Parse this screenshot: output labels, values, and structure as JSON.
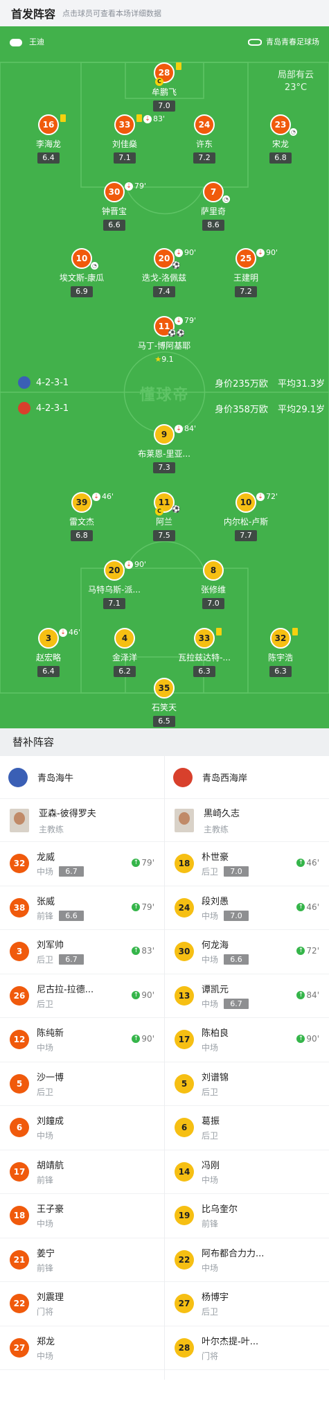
{
  "header": {
    "title": "首发阵容",
    "subtitle": "点击球员可查看本场详细数据"
  },
  "pitch_info": {
    "referee": "王迪",
    "stadium": "青岛青春足球场",
    "weather": "局部有云",
    "temperature": "23°C",
    "watermark": "懂球帝"
  },
  "colors": {
    "pitch": "#42b14b",
    "home": "#f05a0c",
    "away": "#f6bf13"
  },
  "home_team": {
    "name": "青岛海牛",
    "formation": "4-2-3-1",
    "value": "身价235万欧",
    "avg_age": "平均31.3岁",
    "players": [
      {
        "num": "28",
        "name": "牟鹏飞",
        "rating": "7.0"
      },
      {
        "num": "16",
        "name": "李海龙",
        "rating": "6.4"
      },
      {
        "num": "33",
        "name": "刘佳燊",
        "rating": "7.1",
        "sub_min": "83'"
      },
      {
        "num": "24",
        "name": "许东",
        "rating": "7.2"
      },
      {
        "num": "23",
        "name": "宋龙",
        "rating": "6.8"
      },
      {
        "num": "30",
        "name": "钟晋宝",
        "rating": "6.6",
        "sub_min": "79'"
      },
      {
        "num": "7",
        "name": "萨里奇",
        "rating": "8.6"
      },
      {
        "num": "10",
        "name": "埃文斯-康瓜",
        "rating": "6.9"
      },
      {
        "num": "20",
        "name": "迭戈-洛佩兹",
        "rating": "7.4",
        "sub_min": "90'"
      },
      {
        "num": "25",
        "name": "王建明",
        "rating": "7.2",
        "sub_min": "90'"
      },
      {
        "num": "11",
        "name": "马丁-博阿基耶",
        "rating": "9.1",
        "sub_min": "79'"
      }
    ]
  },
  "away_team": {
    "name": "青岛西海岸",
    "formation": "4-2-3-1",
    "value": "身价358万欧",
    "avg_age": "平均29.1岁",
    "players": [
      {
        "num": "9",
        "name": "布莱恩-里亚...",
        "rating": "7.3",
        "sub_min": "84'"
      },
      {
        "num": "39",
        "name": "雷文杰",
        "rating": "6.8",
        "sub_min": "46'"
      },
      {
        "num": "11",
        "name": "阿兰",
        "rating": "7.5"
      },
      {
        "num": "10",
        "name": "内尔松-卢斯",
        "rating": "7.7",
        "sub_min": "72'"
      },
      {
        "num": "20",
        "name": "马特乌斯-派...",
        "rating": "7.1",
        "sub_min": "90'"
      },
      {
        "num": "8",
        "name": "张修维",
        "rating": "7.0"
      },
      {
        "num": "3",
        "name": "赵宏略",
        "rating": "6.4",
        "sub_min": "46'"
      },
      {
        "num": "4",
        "name": "金泽洋",
        "rating": "6.2"
      },
      {
        "num": "33",
        "name": "瓦拉兹达特-...",
        "rating": "6.3"
      },
      {
        "num": "32",
        "name": "陈宇浩",
        "rating": "6.3"
      },
      {
        "num": "35",
        "name": "石笑天",
        "rating": "6.5"
      }
    ]
  },
  "subs": {
    "title": "替补阵容",
    "home": {
      "team": "青岛海牛",
      "coach": {
        "name": "亚森-彼得罗夫",
        "role": "主教练"
      },
      "players": [
        {
          "num": "32",
          "name": "龙威",
          "pos": "中场",
          "rating": "6.7",
          "on": "79'"
        },
        {
          "num": "38",
          "name": "张威",
          "pos": "前锋",
          "rating": "6.6",
          "on": "79'"
        },
        {
          "num": "3",
          "name": "刘军帅",
          "pos": "后卫",
          "rating": "6.7",
          "on": "83'"
        },
        {
          "num": "26",
          "name": "尼古拉-拉德...",
          "pos": "后卫",
          "rating": "",
          "on": "90'"
        },
        {
          "num": "12",
          "name": "陈纯新",
          "pos": "中场",
          "rating": "",
          "on": "90'"
        },
        {
          "num": "5",
          "name": "沙一博",
          "pos": "后卫",
          "rating": "",
          "on": ""
        },
        {
          "num": "6",
          "name": "刘鐘成",
          "pos": "中场",
          "rating": "",
          "on": ""
        },
        {
          "num": "17",
          "name": "胡靖航",
          "pos": "前锋",
          "rating": "",
          "on": ""
        },
        {
          "num": "18",
          "name": "王子豪",
          "pos": "中场",
          "rating": "",
          "on": ""
        },
        {
          "num": "21",
          "name": "姜宁",
          "pos": "前锋",
          "rating": "",
          "on": ""
        },
        {
          "num": "22",
          "name": "刘震理",
          "pos": "门将",
          "rating": "",
          "on": ""
        },
        {
          "num": "27",
          "name": "郑龙",
          "pos": "中场",
          "rating": "",
          "on": ""
        }
      ]
    },
    "away": {
      "team": "青岛西海岸",
      "coach": {
        "name": "黒崎久志",
        "role": "主教练"
      },
      "players": [
        {
          "num": "18",
          "name": "朴世豪",
          "pos": "后卫",
          "rating": "7.0",
          "on": "46'"
        },
        {
          "num": "24",
          "name": "段刘愚",
          "pos": "中场",
          "rating": "7.0",
          "on": "46'"
        },
        {
          "num": "30",
          "name": "何龙海",
          "pos": "中场",
          "rating": "6.6",
          "on": "72'"
        },
        {
          "num": "13",
          "name": "谭凯元",
          "pos": "中场",
          "rating": "6.7",
          "on": "84'"
        },
        {
          "num": "17",
          "name": "陈柏良",
          "pos": "中场",
          "rating": "",
          "on": "90'"
        },
        {
          "num": "5",
          "name": "刘谱锦",
          "pos": "后卫",
          "rating": "",
          "on": ""
        },
        {
          "num": "6",
          "name": "葛振",
          "pos": "后卫",
          "rating": "",
          "on": ""
        },
        {
          "num": "14",
          "name": "冯刚",
          "pos": "中场",
          "rating": "",
          "on": ""
        },
        {
          "num": "19",
          "name": "比乌奎尔",
          "pos": "前锋",
          "rating": "",
          "on": ""
        },
        {
          "num": "22",
          "name": "阿布都合力力...",
          "pos": "中场",
          "rating": "",
          "on": ""
        },
        {
          "num": "27",
          "name": "杨博宇",
          "pos": "后卫",
          "rating": "",
          "on": ""
        },
        {
          "num": "28",
          "name": "叶尔杰提-叶...",
          "pos": "门将",
          "rating": "",
          "on": ""
        }
      ]
    }
  }
}
